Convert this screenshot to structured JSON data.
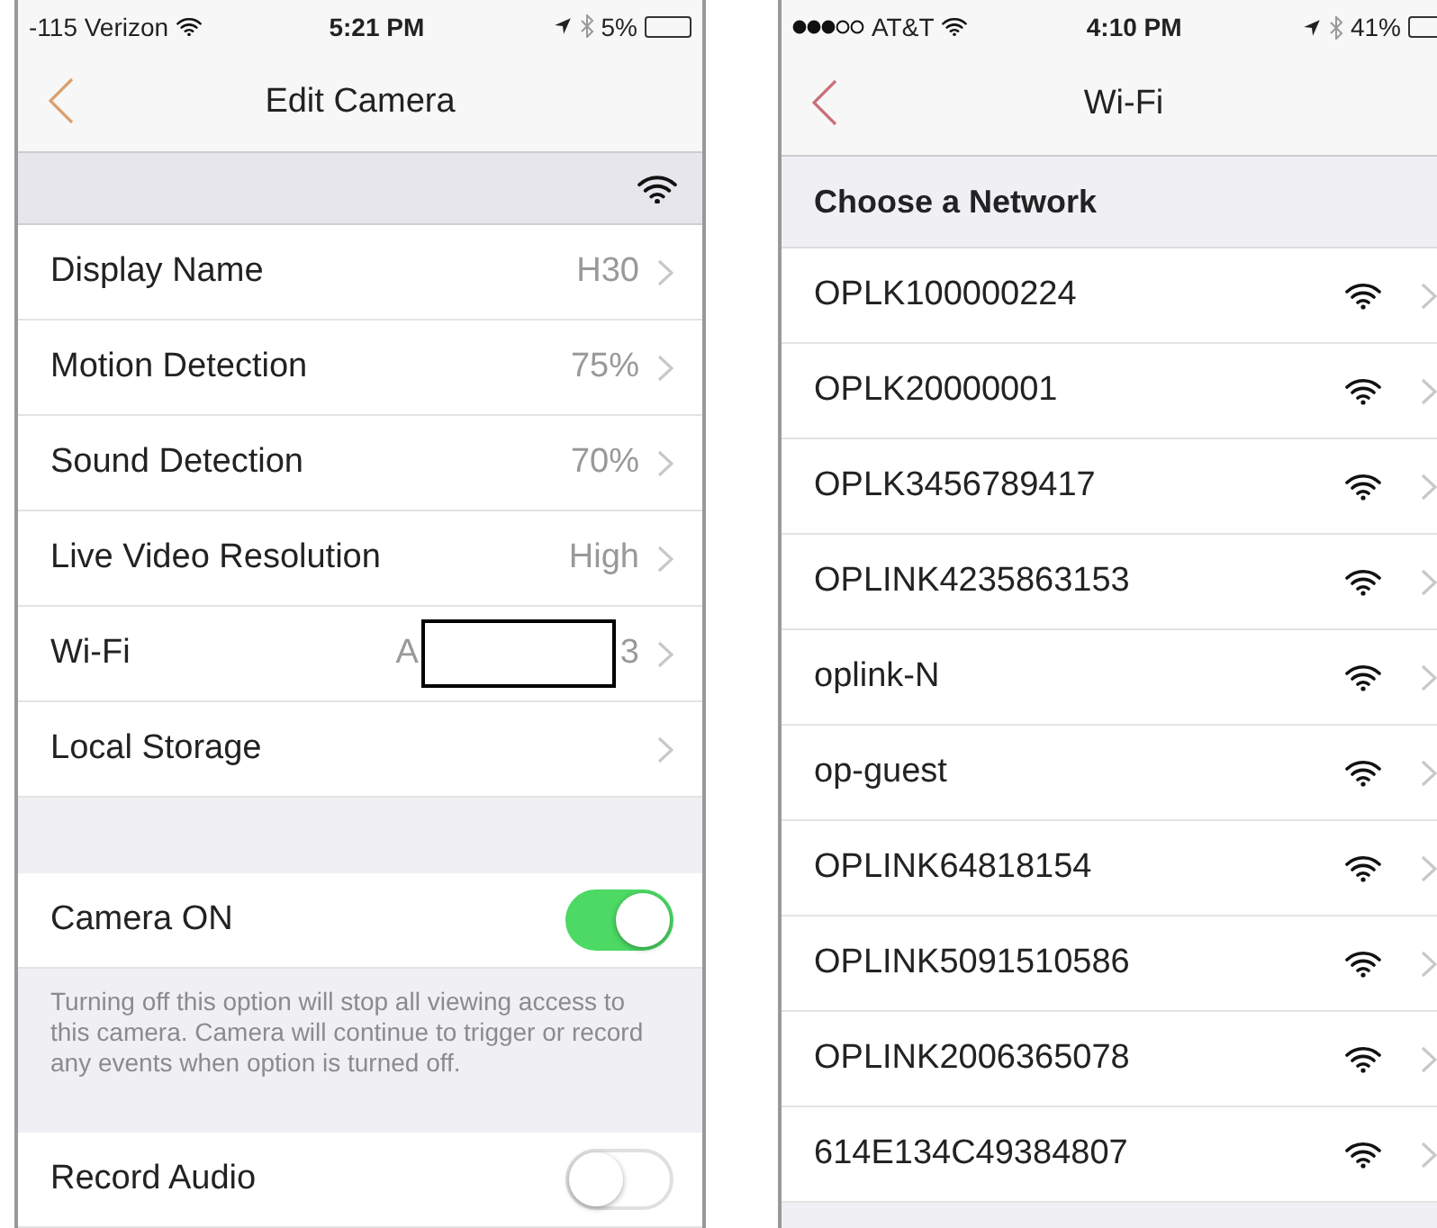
{
  "left": {
    "status_bar": {
      "carrier": "-115 Verizon",
      "time": "5:21 PM",
      "battery": "5%"
    },
    "nav": {
      "title": "Edit Camera"
    },
    "settings": [
      {
        "kind": "link",
        "label": "Display Name",
        "value": "H30"
      },
      {
        "kind": "link",
        "label": "Motion Detection",
        "value": "75%"
      },
      {
        "kind": "link",
        "label": "Sound Detection",
        "value": "70%"
      },
      {
        "kind": "link",
        "label": "Live Video Resolution",
        "value": "High"
      },
      {
        "kind": "redacted",
        "label": "Wi-Fi",
        "value_start": "A",
        "value_end": "3"
      },
      {
        "kind": "link",
        "label": "Local Storage"
      }
    ],
    "camera_toggle": {
      "label": "Camera ON",
      "on": true
    },
    "note": "Turning off this option will stop all viewing access to this camera. Camera will continue to trigger or record any events when option is turned off.",
    "audio_toggle": {
      "label": "Record Audio",
      "on": false
    }
  },
  "right": {
    "status_bar": {
      "carrier": "AT&T",
      "time": "4:10 PM",
      "battery": "41%"
    },
    "nav": {
      "title": "Wi-Fi"
    },
    "section_header": "Choose a Network",
    "networks": [
      "OPLK100000224",
      "OPLK20000001",
      "OPLK3456789417",
      "OPLINK4235863153",
      "oplink-N",
      "op-guest",
      "OPLINK64818154",
      "OPLINK5091510586",
      "OPLINK2006365078",
      "614E134C49384807"
    ]
  }
}
